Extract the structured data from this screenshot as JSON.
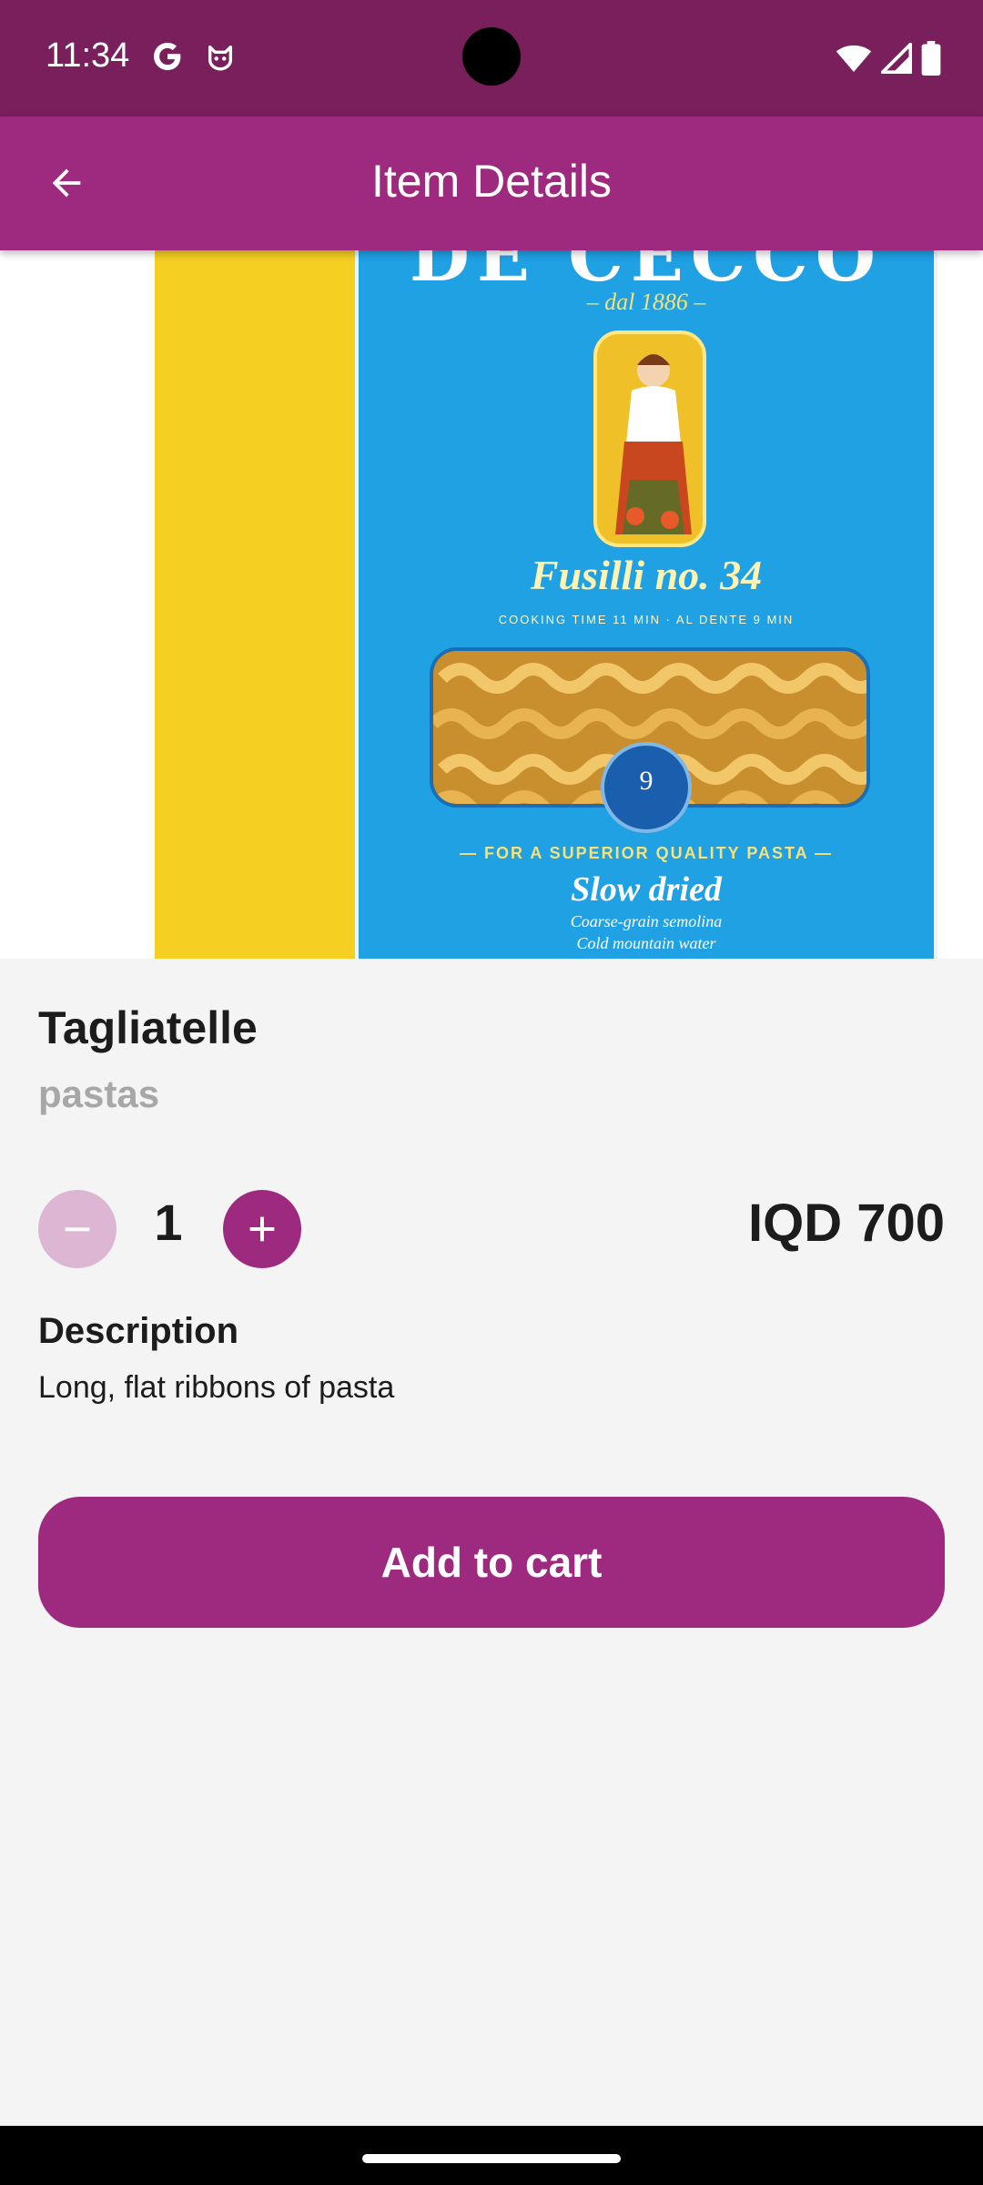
{
  "status_bar": {
    "time": "11:34",
    "icons": [
      "google-g-icon",
      "cat-notification-icon",
      "wifi-icon",
      "cell-signal-icon",
      "battery-icon"
    ]
  },
  "app_bar": {
    "title": "Item Details",
    "back_icon": "arrow-back-icon"
  },
  "product_image": {
    "brand": "DE CECCO",
    "since": "– dal 1886 –",
    "product": "Fusilli no. 34",
    "smallprint": "COOKING TIME 11 MIN · AL DENTE 9 MIN",
    "badge": "9",
    "tagline": "— FOR A SUPERIOR QUALITY PASTA —",
    "slogan": "Slow dried",
    "ingredient_1": "Coarse-grain semolina",
    "ingredient_2": "Cold mountain water"
  },
  "item": {
    "name": "Tagliatelle",
    "category": "pastas",
    "quantity": "1",
    "price": "IQD 700"
  },
  "description": {
    "title": "Description",
    "text": "Long, flat ribbons of pasta"
  },
  "actions": {
    "add_to_cart": "Add to cart",
    "decrement_icon": "minus-icon",
    "increment_icon": "plus-icon"
  },
  "colors": {
    "status_bar": "#781f5c",
    "primary": "#9e2a7f",
    "primary_disabled": "#dcb6d3",
    "background": "#f4f4f4"
  }
}
